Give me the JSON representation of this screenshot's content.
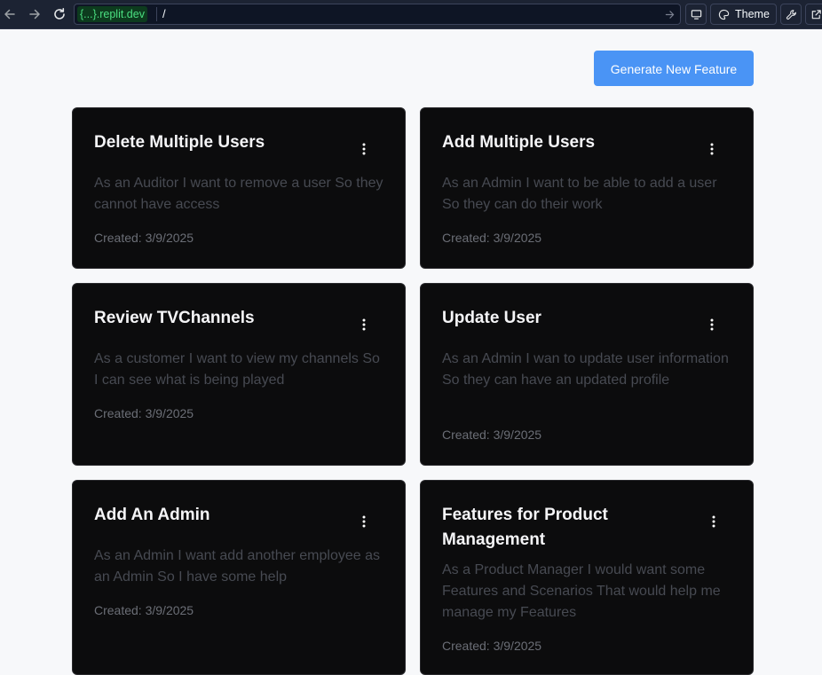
{
  "browser": {
    "url_domain": "{...}.replit.dev",
    "url_path": "/",
    "theme_label": "Theme"
  },
  "header": {
    "generate_button_label": "Generate New Feature"
  },
  "features": [
    {
      "title": "Delete Multiple Users",
      "description": "As an Auditor I want to remove a user So they cannot have access",
      "created": "Created: 3/9/2025"
    },
    {
      "title": "Add Multiple Users",
      "description": "As an Admin I want to be able to add a user So they can do their work",
      "created": "Created: 3/9/2025"
    },
    {
      "title": "Review TVChannels",
      "description": "As a customer I want to view my channels So I can see what is being played",
      "created": "Created: 3/9/2025"
    },
    {
      "title": "Update User",
      "description": "As an Admin I wan to update user information So they can have an updated profile",
      "created": "Created: 3/9/2025"
    },
    {
      "title": "Add An Admin",
      "description": "As an Admin I want add another employee as an Admin So I have some help",
      "created": "Created: 3/9/2025"
    },
    {
      "title": "Features for Product Management",
      "description": "As a Product Manager I would want some Features and Scenarios That would help me manage my Features",
      "created": "Created: 3/9/2025"
    }
  ],
  "colors": {
    "page_background": "#f7f8fa",
    "card_background": "#0c0c0d",
    "primary_button": "#4a94f5",
    "browser_toolbar": "#1c2333",
    "url_domain_text": "#4ade80"
  },
  "icons": {
    "back": "arrow-left-icon",
    "forward": "arrow-right-icon",
    "reload": "reload-icon",
    "go": "arrow-right-icon",
    "devtools": "monitor-icon",
    "theme": "palette-icon",
    "tools": "wrench-icon",
    "open_new_tab": "external-link-icon",
    "card_menu": "more-vertical-icon"
  }
}
